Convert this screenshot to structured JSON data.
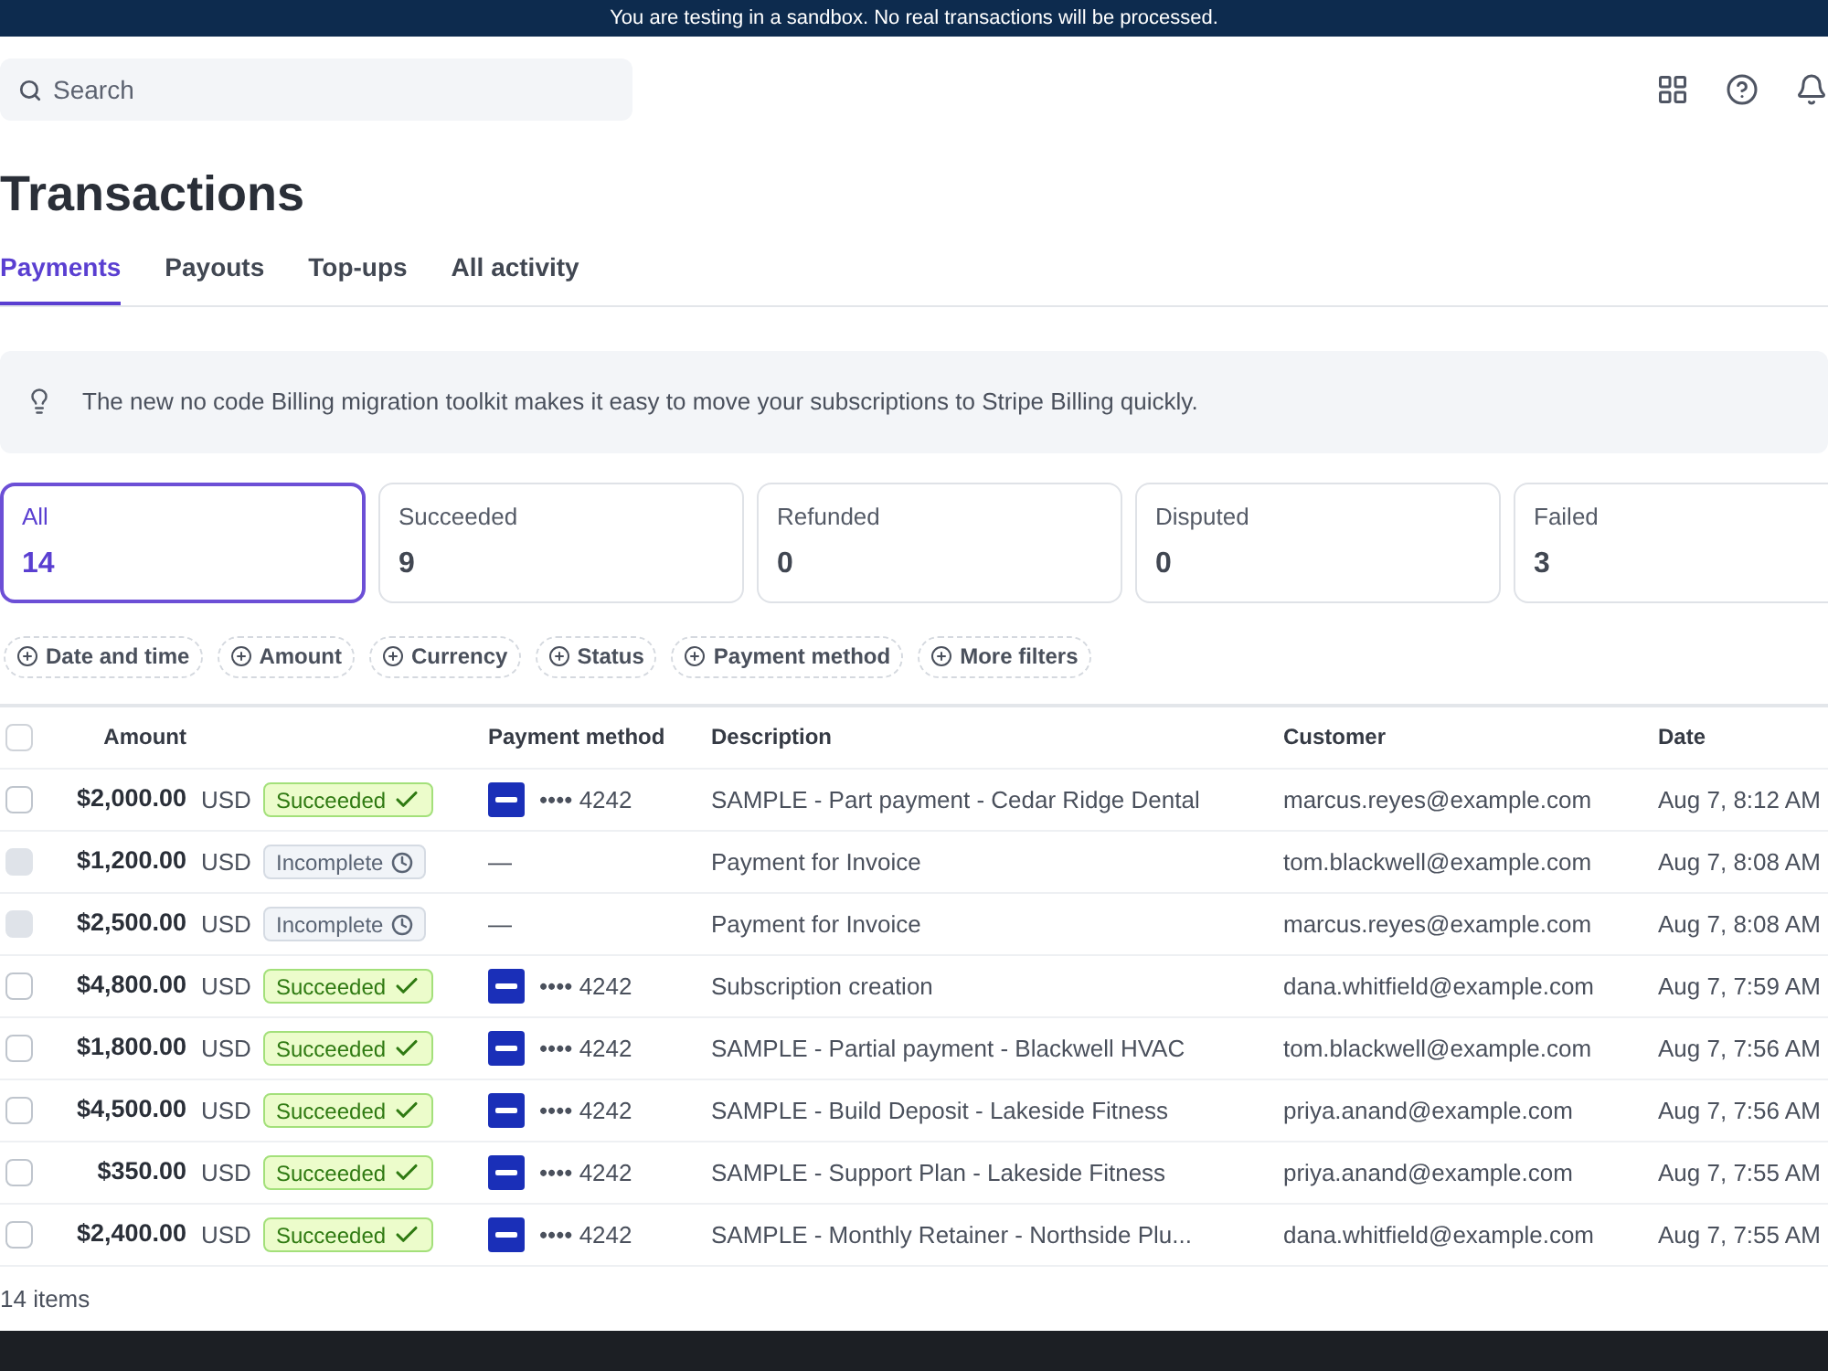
{
  "banner": {
    "text": "You are testing in a sandbox. No real transactions will be processed."
  },
  "search": {
    "placeholder": "Search"
  },
  "title": "Transactions",
  "tabs": [
    {
      "label": "Payments",
      "selected": true
    },
    {
      "label": "Payouts",
      "selected": false
    },
    {
      "label": "Top-ups",
      "selected": false
    },
    {
      "label": "All activity",
      "selected": false
    }
  ],
  "notice": "The new no code Billing migration toolkit makes it easy to move your subscriptions to Stripe Billing quickly.",
  "status_cards": [
    {
      "label": "All",
      "count": "14",
      "selected": true
    },
    {
      "label": "Succeeded",
      "count": "9",
      "selected": false
    },
    {
      "label": "Refunded",
      "count": "0",
      "selected": false
    },
    {
      "label": "Disputed",
      "count": "0",
      "selected": false
    },
    {
      "label": "Failed",
      "count": "3",
      "selected": false
    }
  ],
  "filters": [
    "Date and time",
    "Amount",
    "Currency",
    "Status",
    "Payment method",
    "More filters"
  ],
  "table": {
    "select_all": {
      "checked": false
    },
    "columns": [
      "Amount",
      "Payment method",
      "Description",
      "Customer",
      "Date"
    ],
    "rows": [
      {
        "disabled": false,
        "amount": "$2,000.00",
        "currency": "USD",
        "status": {
          "kind": "succeeded",
          "label": "Succeeded"
        },
        "method": "•••• 4242",
        "description": "SAMPLE - Part payment - Cedar Ridge Dental",
        "customer": "marcus.reyes@example.com",
        "date": "Aug 7, 8:12 AM"
      },
      {
        "disabled": true,
        "amount": "$1,200.00",
        "currency": "USD",
        "status": {
          "kind": "incomplete",
          "label": "Incomplete"
        },
        "method": "—",
        "description": "Payment for Invoice",
        "customer": "tom.blackwell@example.com",
        "date": "Aug 7, 8:08 AM"
      },
      {
        "disabled": true,
        "amount": "$2,500.00",
        "currency": "USD",
        "status": {
          "kind": "incomplete",
          "label": "Incomplete"
        },
        "method": "—",
        "description": "Payment for Invoice",
        "customer": "marcus.reyes@example.com",
        "date": "Aug 7, 8:08 AM"
      },
      {
        "disabled": false,
        "amount": "$4,800.00",
        "currency": "USD",
        "status": {
          "kind": "succeeded",
          "label": "Succeeded"
        },
        "method": "•••• 4242",
        "description": "Subscription creation",
        "customer": "dana.whitfield@example.com",
        "date": "Aug 7, 7:59 AM"
      },
      {
        "disabled": false,
        "amount": "$1,800.00",
        "currency": "USD",
        "status": {
          "kind": "succeeded",
          "label": "Succeeded"
        },
        "method": "•••• 4242",
        "description": "SAMPLE - Partial payment - Blackwell HVAC",
        "customer": "tom.blackwell@example.com",
        "date": "Aug 7, 7:56 AM"
      },
      {
        "disabled": false,
        "amount": "$4,500.00",
        "currency": "USD",
        "status": {
          "kind": "succeeded",
          "label": "Succeeded"
        },
        "method": "•••• 4242",
        "description": "SAMPLE - Build Deposit - Lakeside Fitness",
        "customer": "priya.anand@example.com",
        "date": "Aug 7, 7:56 AM"
      },
      {
        "disabled": false,
        "amount": "$350.00",
        "currency": "USD",
        "status": {
          "kind": "succeeded",
          "label": "Succeeded"
        },
        "method": "•••• 4242",
        "description": "SAMPLE - Support Plan - Lakeside Fitness",
        "customer": "priya.anand@example.com",
        "date": "Aug 7, 7:55 AM"
      },
      {
        "disabled": false,
        "amount": "$2,400.00",
        "currency": "USD",
        "status": {
          "kind": "succeeded",
          "label": "Succeeded"
        },
        "method": "•••• 4242",
        "description": "SAMPLE - Monthly Retainer - Northside Plu...",
        "customer": "dana.whitfield@example.com",
        "date": "Aug 7, 7:55 AM"
      }
    ]
  },
  "footer": "14 items"
}
